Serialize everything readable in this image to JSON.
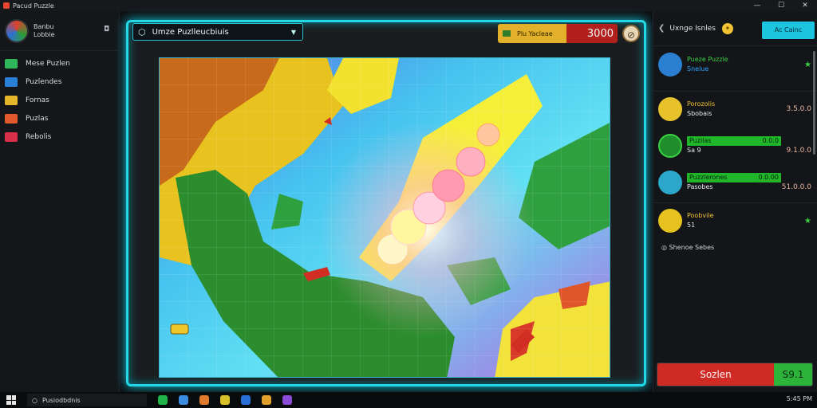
{
  "window": {
    "title": "Pacud Puzzle",
    "controls": [
      "—",
      "☐",
      "✕"
    ]
  },
  "sidebar": {
    "profile": {
      "line1": "Banbu",
      "line2": "Lobbie"
    },
    "items": [
      {
        "label": "Mese Puzlen",
        "color": "#2fb55a"
      },
      {
        "label": "Puzlendes",
        "color": "#2a7fd6"
      },
      {
        "label": "Fornas",
        "color": "#e5b62a"
      },
      {
        "label": "Puzlas",
        "color": "#e2592c"
      },
      {
        "label": "Rebolis",
        "color": "#d92f4a"
      }
    ]
  },
  "board": {
    "select_label": "Umze Puzlleucbiuis",
    "score_label": "Plu Yacleae",
    "score_value": "3000"
  },
  "right_panel": {
    "username": "Uxnge Isnles",
    "cta_label": "Ac Cainc",
    "players": [
      {
        "name": "Pueze Puzzle",
        "sub": "Snelue",
        "score": "",
        "starred": true,
        "avatar_color": "#2b7fd1"
      },
      {
        "name": "Porozolis",
        "sub": "Sbobais",
        "score": "3.5.0.0",
        "starred": false,
        "avatar_color": "#e8c22a"
      },
      {
        "name": "Puzilas",
        "sub": "Sa 9",
        "score": "9.1.0.0",
        "score_top": "0.0.0",
        "starred": false,
        "avatar_color": "#1f8d2c"
      },
      {
        "name": "Puzzlerones",
        "sub": "Pasobes",
        "score": "51.0.0.0",
        "score_top": "0.0.00",
        "starred": false,
        "avatar_color": "#2aa7c9"
      },
      {
        "name": "Poobvile",
        "sub": "51",
        "score": "",
        "starred": true,
        "avatar_color": "#e6c21f"
      }
    ],
    "sub_note": "Shenoe Sebes",
    "bottom_left": "Sozlen",
    "bottom_right": "S9.1"
  },
  "taskbar": {
    "search_text": "Pusiodbdnis",
    "tray_time": "5:45 PM"
  }
}
